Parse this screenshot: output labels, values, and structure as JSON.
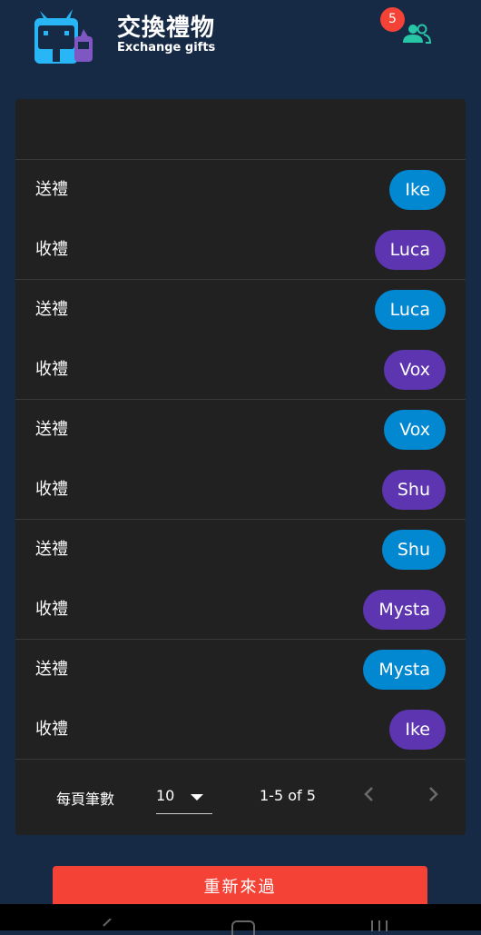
{
  "header": {
    "title": "交換禮物",
    "subtitle": "Exchange gifts",
    "notification_count": "5",
    "logo_icon": "gift-cat-logo",
    "people_icon": "people-icon"
  },
  "list": {
    "pairs": [
      {
        "send_label": "送禮",
        "giver": "Ike",
        "receive_label": "收禮",
        "receiver": "Luca"
      },
      {
        "send_label": "送禮",
        "giver": "Luca",
        "receive_label": "收禮",
        "receiver": "Vox"
      },
      {
        "send_label": "送禮",
        "giver": "Vox",
        "receive_label": "收禮",
        "receiver": "Shu"
      },
      {
        "send_label": "送禮",
        "giver": "Shu",
        "receive_label": "收禮",
        "receiver": "Mysta"
      },
      {
        "send_label": "送禮",
        "giver": "Mysta",
        "receive_label": "收禮",
        "receiver": "Ike"
      }
    ]
  },
  "pagination": {
    "rows_per_page_label": "每頁筆數",
    "rows_per_page_value": "10",
    "range_text": "1-5 of 5"
  },
  "reset_button": {
    "label": "重新來過"
  },
  "colors": {
    "background": "#172a45",
    "card": "#212121",
    "giver_chip": "#0288d1",
    "receiver_chip": "#5e35b1",
    "accent_red": "#f44336",
    "people_icon": "#26c6a6"
  }
}
